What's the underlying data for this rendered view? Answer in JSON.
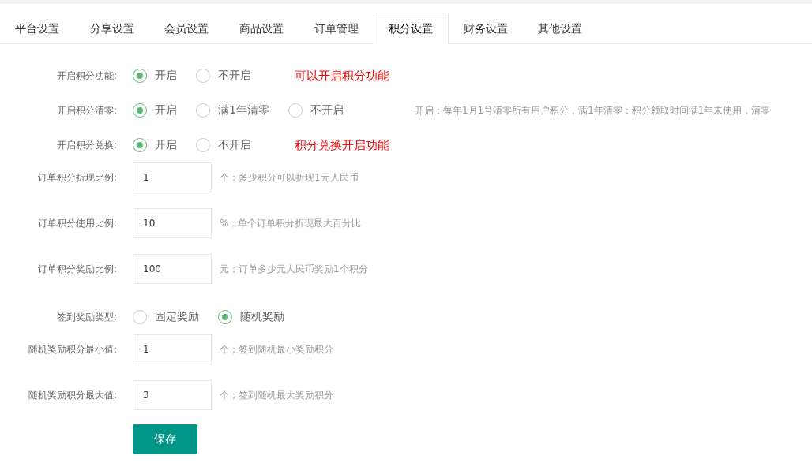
{
  "tabs": [
    {
      "label": "平台设置",
      "selected": false
    },
    {
      "label": "分享设置",
      "selected": false
    },
    {
      "label": "会员设置",
      "selected": false
    },
    {
      "label": "商品设置",
      "selected": false
    },
    {
      "label": "订单管理",
      "selected": false
    },
    {
      "label": "积分设置",
      "selected": true
    },
    {
      "label": "财务设置",
      "selected": false
    },
    {
      "label": "其他设置",
      "selected": false
    }
  ],
  "form": {
    "rows": [
      {
        "kind": "radio",
        "label": "开启积分功能:",
        "options": [
          {
            "label": "开启",
            "selected": true
          },
          {
            "label": "不开启",
            "selected": false
          }
        ],
        "note": {
          "kind": "alert",
          "text": "可以开启积分功能"
        }
      },
      {
        "kind": "radio",
        "label": "开启积分清零:",
        "options": [
          {
            "label": "开启",
            "selected": true
          },
          {
            "label": "满1年清零",
            "selected": false
          },
          {
            "label": "不开启",
            "selected": false
          }
        ],
        "note": {
          "kind": "hint",
          "text": "开启：每年1月1号清零所有用户积分，满1年清零：积分领取时间满1年未使用，清零"
        }
      },
      {
        "kind": "radio",
        "label": "开启积分兑换:",
        "options": [
          {
            "label": "开启",
            "selected": true
          },
          {
            "label": "不开启",
            "selected": false
          }
        ],
        "note": {
          "kind": "alert",
          "text": "积分兑换开启功能"
        }
      },
      {
        "kind": "input",
        "label": "订单积分折现比例:",
        "value": "1",
        "hint": "个；多少积分可以折现1元人民币"
      },
      {
        "kind": "input",
        "label": "订单积分使用比例:",
        "value": "10",
        "hint": "%；单个订单积分折现最大百分比"
      },
      {
        "kind": "input",
        "label": "订单积分奖励比例:",
        "value": "100",
        "hint": "元；订单多少元人民币奖励1个积分"
      },
      {
        "kind": "radio",
        "label": "签到奖励类型:",
        "options": [
          {
            "label": "固定奖励",
            "selected": false
          },
          {
            "label": "随机奖励",
            "selected": true
          }
        ]
      },
      {
        "kind": "input",
        "label": "随机奖励积分最小值:",
        "value": "1",
        "hint": "个；签到随机最小奖励积分"
      },
      {
        "kind": "input",
        "label": "随机奖励积分最大值:",
        "value": "3",
        "hint": "个；签到随机最大奖励积分"
      }
    ],
    "submit": "保存"
  }
}
